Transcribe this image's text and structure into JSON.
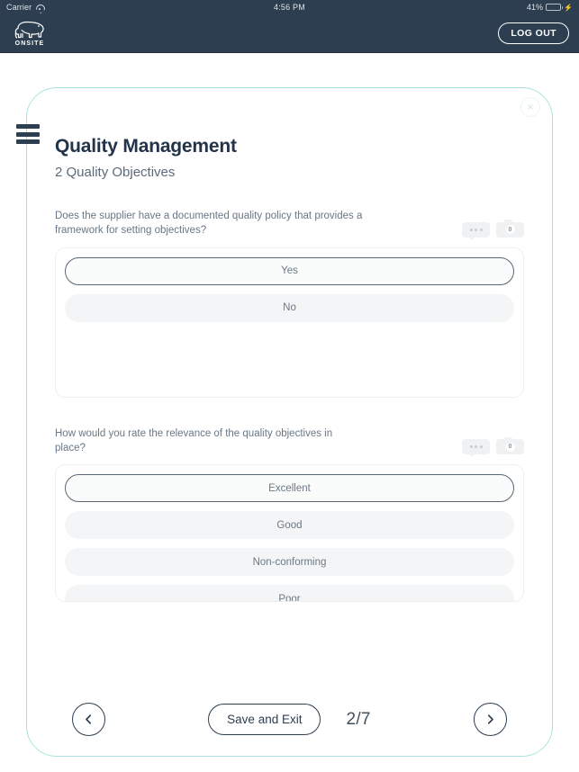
{
  "statusbar": {
    "carrier": "Carrier",
    "wifi_icon": "wifi-icon",
    "time": "4:56 PM",
    "battery_percent": "41%",
    "battery_level": 41,
    "charging_icon": "lightning-bolt-icon"
  },
  "appbar": {
    "logo_icon": "elephant-logo-icon",
    "brand_name": "ONSITE",
    "logout_label": "LOG OUT",
    "background_color": "#2c3e50"
  },
  "menu": {
    "hamburger_icon": "hamburger-menu-icon"
  },
  "card": {
    "close_label": "×",
    "border_color": "#a9e3e0",
    "title": "Quality Management",
    "subtitle": "2 Quality Objectives"
  },
  "questions": [
    {
      "text": "Does the supplier have a documented quality policy that provides a framework for setting objectives?",
      "comment_badge": {
        "icon": "comment-bubble-icon",
        "label": "•••"
      },
      "photo_badge": {
        "icon": "camera-icon",
        "count": "0"
      },
      "options": [
        {
          "label": "Yes",
          "selected": true
        },
        {
          "label": "No",
          "selected": false
        }
      ]
    },
    {
      "text": "How would you rate the relevance of the quality objectives in place?",
      "comment_badge": {
        "icon": "comment-bubble-icon",
        "label": "•••"
      },
      "photo_badge": {
        "icon": "camera-icon",
        "count": "0"
      },
      "options": [
        {
          "label": "Excellent",
          "selected": true
        },
        {
          "label": "Good",
          "selected": false
        },
        {
          "label": "Non-conforming",
          "selected": false
        },
        {
          "label": "Poor",
          "selected": false
        }
      ]
    }
  ],
  "footer": {
    "prev_icon": "chevron-left-icon",
    "save_exit_label": "Save and Exit",
    "progress": "2/7",
    "next_icon": "chevron-right-icon"
  }
}
